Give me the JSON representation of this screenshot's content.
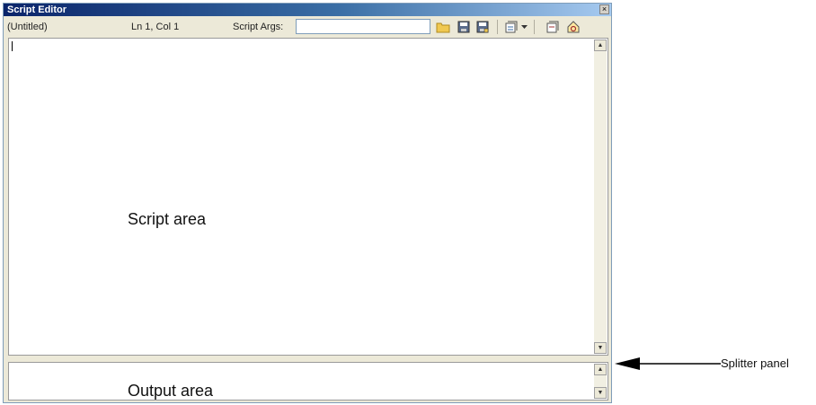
{
  "window": {
    "title": "Script Editor",
    "close_glyph": "×"
  },
  "toolbar": {
    "file_name": "(Untitled)",
    "cursor_position": "Ln 1, Col 1",
    "args_label": "Script Args:",
    "args_value": "",
    "icons": [
      "open-folder-icon",
      "save-icon",
      "save-as-icon",
      "run-script-icon",
      "dropdown-arrow-icon",
      "stop-icon",
      "help-icon"
    ]
  },
  "script_area": {
    "label": "Script area"
  },
  "output_area": {
    "label": "Output area"
  },
  "annotation": {
    "label": "Splitter panel"
  },
  "colors": {
    "titlebar_start": "#0a246a",
    "titlebar_end": "#a6caf0",
    "window_bg": "#ece9d8",
    "folder_icon": "#f0c850"
  }
}
